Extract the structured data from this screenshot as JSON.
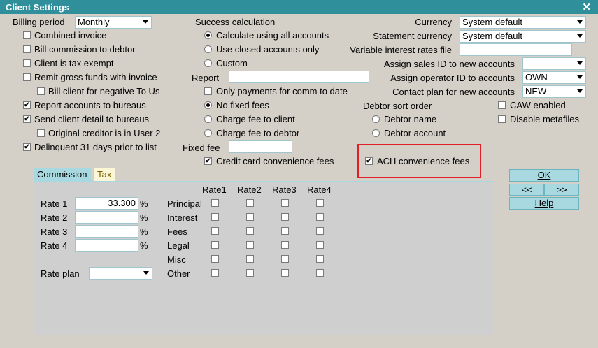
{
  "window": {
    "title": "Client Settings",
    "close": "✕"
  },
  "left": {
    "billing_period_label": "Billing period",
    "billing_period_value": "Monthly",
    "combined_invoice": "Combined invoice",
    "bill_commission": "Bill commission to debtor",
    "tax_exempt": "Client is tax exempt",
    "remit_gross": "Remit gross funds with invoice",
    "bill_negative": "Bill client for negative To Us",
    "report_bureaus": "Report accounts to bureaus",
    "send_detail": "Send client detail to bureaus",
    "original_creditor": "Original creditor is in User 2",
    "delinquent": "Delinquent 31 days prior to list"
  },
  "middle": {
    "success_calc_label": "Success calculation",
    "calc_all": "Calculate using all accounts",
    "use_closed": "Use closed accounts only",
    "custom": "Custom",
    "report_label": "Report",
    "only_payments": "Only payments for comm to date",
    "no_fixed_fees": "No fixed fees",
    "charge_client": "Charge fee to client",
    "charge_debtor": "Charge fee to debtor",
    "fixed_fee_label": "Fixed fee",
    "cc_fees": "Credit card convenience fees"
  },
  "right": {
    "currency_label": "Currency",
    "currency_value": "System default",
    "statement_currency_label": "Statement currency",
    "statement_currency_value": "System default",
    "variable_interest_label": "Variable interest rates file",
    "assign_sales_label": "Assign sales ID to new accounts",
    "assign_operator_label": "Assign operator ID to accounts",
    "assign_operator_value": "OWN",
    "contact_plan_label": "Contact plan for new accounts",
    "contact_plan_value": "NEW",
    "debtor_sort_label": "Debtor sort order",
    "debtor_name": "Debtor name",
    "debtor_account": "Debtor account",
    "caw_enabled": "CAW enabled",
    "disable_metafiles": "Disable metafiles",
    "ach_fees": "ACH convenience fees"
  },
  "buttons": {
    "ok": "OK",
    "prev": "<<",
    "next": ">>",
    "help": "Help"
  },
  "tabs": {
    "commission": "Commission",
    "tax": "Tax"
  },
  "commission": {
    "rate1_label": "Rate 1",
    "rate1_value": "33.300",
    "rate2_label": "Rate 2",
    "rate3_label": "Rate 3",
    "rate4_label": "Rate 4",
    "pct": "%",
    "rate_plan_label": "Rate plan",
    "columns": [
      "Rate1",
      "Rate2",
      "Rate3",
      "Rate4"
    ],
    "rows": [
      "Principal",
      "Interest",
      "Fees",
      "Legal",
      "Misc",
      "Other"
    ]
  },
  "colors": {
    "title_bar": "#2f8f9b",
    "highlight_box": "#e21f26",
    "button": "#a9d9e0"
  }
}
